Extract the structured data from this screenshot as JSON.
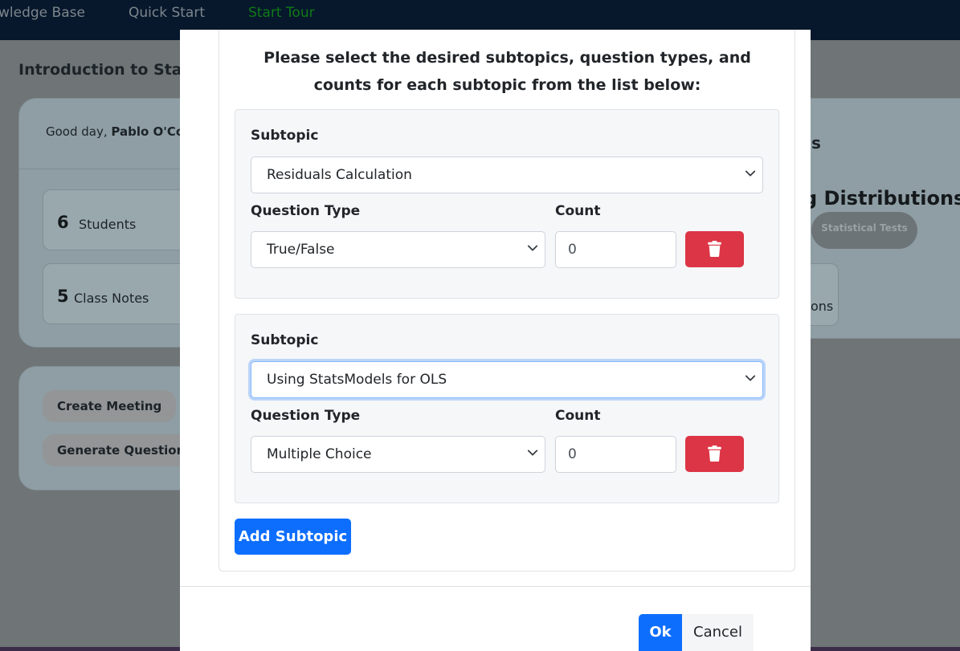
{
  "nav": {
    "items": [
      "wledge Base",
      "Quick Start",
      "Start Tour"
    ],
    "tour_color": "#0f7a17"
  },
  "background": {
    "page_title": "Introduction to Sta",
    "greeting_prefix": "Good day, ",
    "greeting_name": "Pablo O'Co",
    "stats": [
      {
        "number": "6",
        "label": "Students"
      },
      {
        "number": "5",
        "label": "Class Notes"
      }
    ],
    "actions": [
      "Create Meeting",
      "Generate Questions"
    ],
    "right_panel": {
      "text_fragment": "s",
      "heading_fragment": "g Distributions",
      "tag": "Statistical Tests",
      "box_fragment": "ons"
    }
  },
  "modal": {
    "instructions": "Please select the desired subtopics, question types, and counts for each subtopic from the list below:",
    "labels": {
      "subtopic": "Subtopic",
      "question_type": "Question Type",
      "count": "Count"
    },
    "subtopics": [
      {
        "subtopic": "Residuals Calculation",
        "question_type": "True/False",
        "count": "0",
        "focused": false
      },
      {
        "subtopic": "Using StatsModels for OLS",
        "question_type": "Multiple Choice",
        "count": "0",
        "focused": true
      }
    ],
    "add_button": "Add Subtopic",
    "ok_button": "Ok",
    "cancel_button": "Cancel"
  },
  "colors": {
    "primary": "#0d6efd",
    "danger": "#dc3545",
    "nav_bg": "#07182c"
  }
}
